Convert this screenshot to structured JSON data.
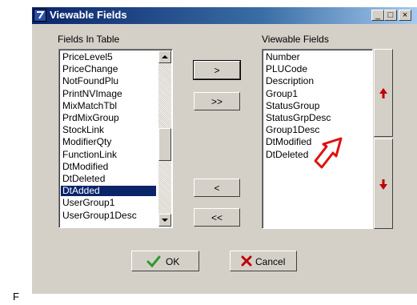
{
  "window": {
    "title": "Viewable Fields",
    "minimize_label": "_",
    "maximize_label": "□",
    "close_label": "×"
  },
  "left_list": {
    "label": "Fields In Table",
    "items": [
      "PriceLevel5",
      "PriceChange",
      "NotFoundPlu",
      "PrintNVImage",
      "MixMatchTbl",
      "PrdMixGroup",
      "StockLink",
      "ModifierQty",
      "FunctionLink",
      "DtModified",
      "DtDeleted",
      "DtAdded",
      "UserGroup1",
      "UserGroup1Desc"
    ],
    "selected": "DtAdded"
  },
  "right_list": {
    "label": "Viewable Fields",
    "items": [
      "Number",
      "PLUCode",
      "Description",
      "Group1",
      "StatusGroup",
      "StatusGrpDesc",
      "Group1Desc",
      "DtModified",
      "DtDeleted"
    ]
  },
  "move_buttons": {
    "add_one": ">",
    "add_all": ">>",
    "remove_one": "<",
    "remove_all": "<<"
  },
  "footer": {
    "ok_label": "OK",
    "cancel_label": "Cancel"
  },
  "annotation": {
    "arrow_color": "#e01010"
  },
  "corner_text": "F"
}
